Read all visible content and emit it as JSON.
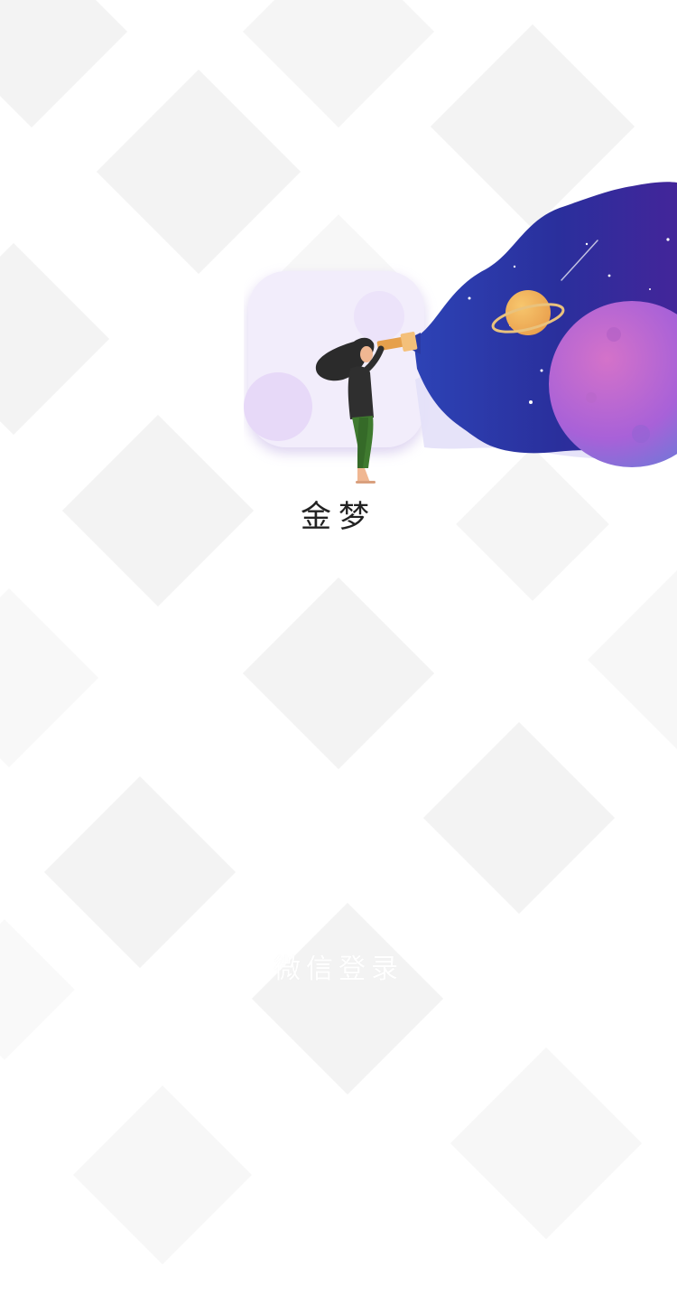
{
  "app": {
    "name": "金梦"
  },
  "login": {
    "wechat_label": "微信登录"
  },
  "colors": {
    "background": "#ffffff",
    "pattern": "#f2f2f2",
    "icon_tile": "#f1ecfb",
    "space_deep": "#25329a",
    "space_mid": "#4b34b8",
    "planet_pink": "#c56ed8",
    "planet_orange": "#f2b55d",
    "title_text": "#222222",
    "button_text": "#ffffff"
  },
  "icons": {
    "logo": "girl-with-telescope-logo",
    "planet": "ringed-planet-icon"
  }
}
